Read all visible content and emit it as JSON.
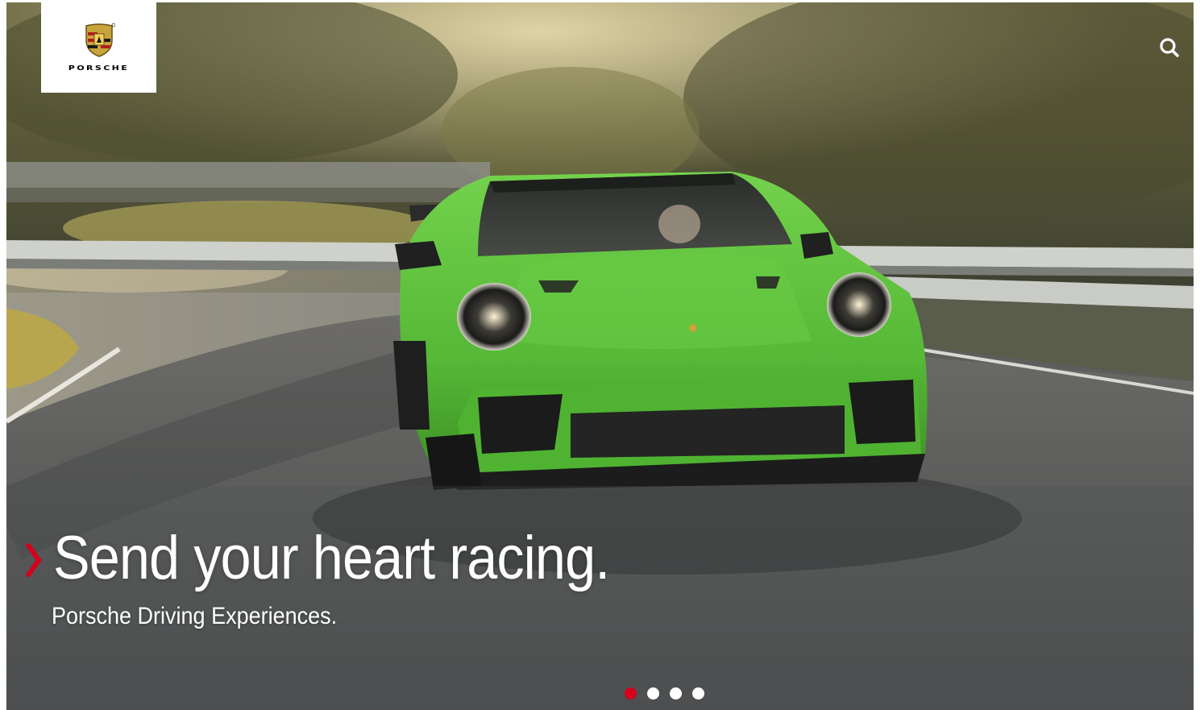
{
  "brand": {
    "name": "PORSCHE",
    "logo_icon": "porsche-crest-icon"
  },
  "header": {
    "search_icon": "search-icon"
  },
  "hero": {
    "headline": "Send your heart racing.",
    "subline": "Porsche Driving Experiences.",
    "accent_color": "#d5001c",
    "car_color": "#5cc13c"
  },
  "carousel": {
    "slide_count": 4,
    "active_index": 0,
    "active_color": "#d5001c",
    "inactive_color": "#ffffff"
  }
}
